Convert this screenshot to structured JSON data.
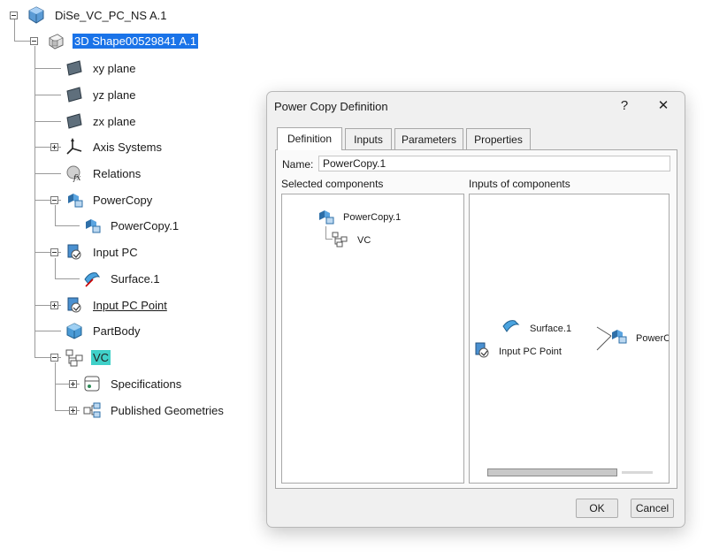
{
  "tree": {
    "root": "DiSe_VC_PC_NS A.1",
    "part": "3D Shape00529841 A.1",
    "items": {
      "xy": "xy plane",
      "yz": "yz plane",
      "zx": "zx plane",
      "axis": "Axis Systems",
      "relations": "Relations",
      "powercopy": "PowerCopy",
      "powercopy1": "PowerCopy.1",
      "inputpc": "Input PC",
      "surface1": "Surface.1",
      "inputpcpoint": "Input PC Point",
      "partbody": "PartBody",
      "vc": "VC",
      "specs": "Specifications",
      "published": "Published Geometries"
    }
  },
  "dialog": {
    "title": "Power Copy Definition",
    "help": "?",
    "close": "✕",
    "tabs": [
      "Definition",
      "Inputs",
      "Parameters",
      "Properties"
    ],
    "name_label": "Name:",
    "name_value": "PowerCopy.1",
    "selected_label": "Selected components",
    "inputs_label": "Inputs of components",
    "selected_tree": {
      "root": "PowerCopy.1",
      "child": "VC"
    },
    "inputs_graph": {
      "surface": "Surface.1",
      "point": "Input PC Point",
      "powercopy": "PowerC"
    },
    "ok": "OK",
    "cancel": "Cancel"
  }
}
